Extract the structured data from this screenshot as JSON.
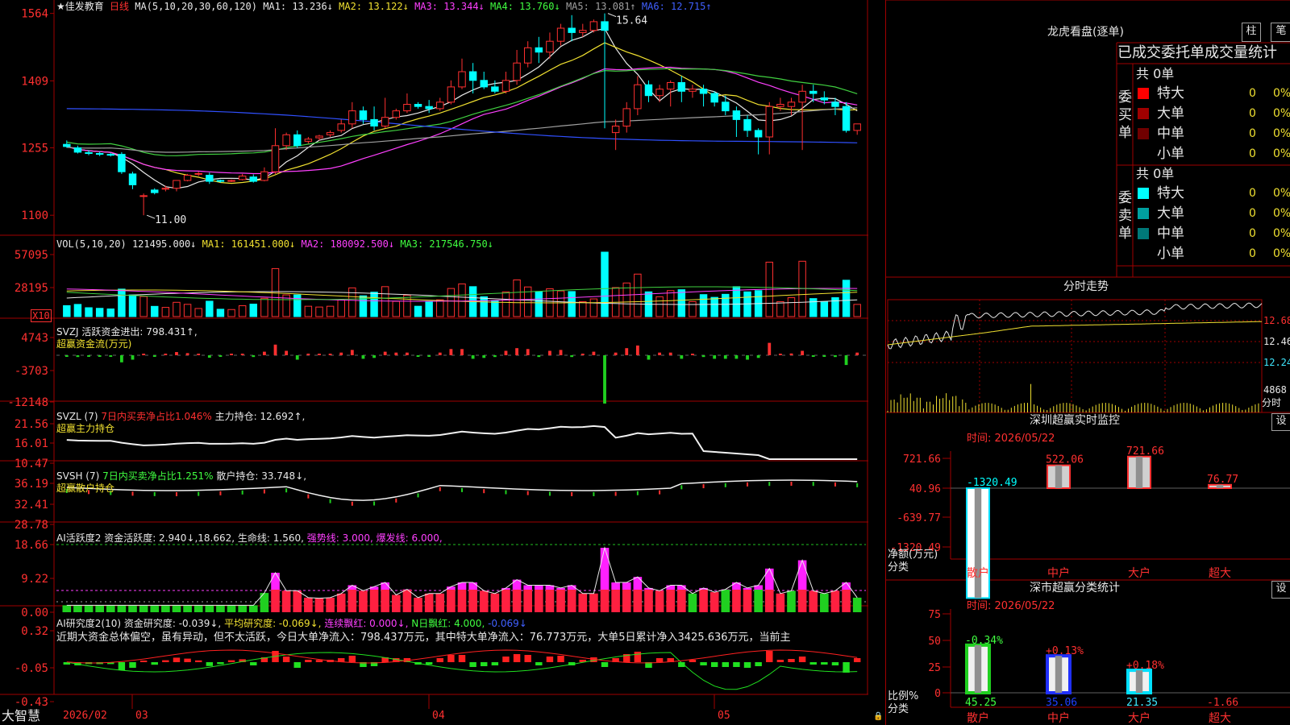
{
  "main": {
    "title": "★佳发教育",
    "period": "日线",
    "ma_header": "MA(5,10,20,30,60,120)",
    "ma1": "MA1: 13.236↓",
    "ma2": "MA2: 13.122↓",
    "ma3": "MA3: 13.344↓",
    "ma4": "MA4: 13.760↓",
    "ma5": "MA5: 13.081↑",
    "ma6": "MA6: 12.715↑",
    "y_ticks": [
      "1564",
      "1409",
      "1255",
      "1100"
    ],
    "high_mark": "15.64",
    "low_mark": "11.00"
  },
  "vol": {
    "header": "VOL(5,10,20)",
    "value": "121495.000↓",
    "ma1": "MA1: 161451.000↓",
    "ma2": "MA2: 180092.500↓",
    "ma3": "MA3: 217546.750↓",
    "y_ticks": [
      "57095",
      "28195"
    ],
    "unit": "X10"
  },
  "svzj": {
    "header": "SVZJ  活跃资金进出: 798.431↑,",
    "sub": "超赢资金流(万元)",
    "y_ticks": [
      "4743",
      "-3703",
      "-12148"
    ]
  },
  "svzl": {
    "header": "SVZL (7)",
    "pct": "7日内买卖净占比1.046%",
    "hold": "主力持仓: 12.692↑,",
    "sub": "超赢主力持仓",
    "y_ticks": [
      "21.56",
      "16.01",
      "10.47"
    ]
  },
  "svsh": {
    "header": "SVSH (7)",
    "pct": "7日内买卖净占比1.251%",
    "hold": "散户持仓: 33.748↓,",
    "sub": "超赢散户持仓",
    "y_ticks": [
      "36.19",
      "32.41",
      "28.78"
    ]
  },
  "ai1": {
    "header": "AI活跃度2 资金活跃度: 2.940↓,18.662,",
    "life": "生命线: 1.560,",
    "strong": "强势线: 3.000,",
    "burst": "爆发线: 6.000,",
    "y_ticks": [
      "18.66",
      "9.22",
      "0.00"
    ]
  },
  "ai2": {
    "header": "AI研究度2(10) 资金研究度: -0.039↓,",
    "avg": "平均研究度: -0.069↓,",
    "lianxu": "连续飘红: 0.000↓,",
    "nri": "N日飘红: 4.000,",
    "last": "-0.069↓",
    "comment": "近期大资金总体偏空，虽有异动，但不太活跃，今日大单净流入：798.437万元，其中特大单净流入：76.773万元，大单5日累计净入3425.636万元，当前主",
    "y_ticks": [
      "0.32",
      "-0.05",
      "-0.43"
    ]
  },
  "bottom": {
    "brand": "大智慧",
    "dates": [
      "2026/02",
      "03",
      "04",
      "05"
    ]
  },
  "right": {
    "dragon_title": "龙虎看盘(逐单)",
    "btn_zhu": "柱",
    "btn_bi": "笔",
    "stat_title": "已成交委托单成交量统计",
    "buy_label": "委买单",
    "sell_label": "委卖单",
    "buy_total": "共 0单",
    "sell_total": "共 0单",
    "buy_rows": [
      {
        "name": "特大",
        "count": "0",
        "pct": "0%",
        "color": "#ff0000"
      },
      {
        "name": "大单",
        "count": "0",
        "pct": "0%",
        "color": "#a00000"
      },
      {
        "name": "中单",
        "count": "0",
        "pct": "0%",
        "color": "#700000"
      },
      {
        "name": "小单",
        "count": "0",
        "pct": "0%",
        "color": ""
      }
    ],
    "sell_rows": [
      {
        "name": "特大",
        "count": "0",
        "pct": "0%",
        "color": "#00ffff"
      },
      {
        "name": "大单",
        "count": "0",
        "pct": "0%",
        "color": "#00a0a0"
      },
      {
        "name": "中单",
        "count": "0",
        "pct": "0%",
        "color": "#007878"
      },
      {
        "name": "小单",
        "count": "0",
        "pct": "0%",
        "color": ""
      }
    ],
    "fenshi_title": "分时走势",
    "fenshi_ticks": [
      "12.68",
      "12.46",
      "12.24"
    ],
    "fenshi_vol": "4868",
    "fenshi_unit": "分时",
    "sz_title": "深圳超赢实时监控",
    "sz_btn": "设",
    "sz_time": "时间: 2026/05/22",
    "sz_ticks": [
      "721.66",
      "40.96",
      "-639.77",
      "-1320.49"
    ],
    "sz_net_label": "净额(万元)",
    "sz_cat_label": "分类",
    "sz_bars": [
      {
        "cat": "散户",
        "value": -1320.49,
        "label": "-1320.49"
      },
      {
        "cat": "中户",
        "value": 522.06,
        "label": "522.06"
      },
      {
        "cat": "大户",
        "value": 721.66,
        "label": "721.66"
      },
      {
        "cat": "超大",
        "value": 76.77,
        "label": "76.77"
      }
    ],
    "ss_title": "深市超赢分类统计",
    "ss_btn": "设",
    "ss_time": "时间: 2026/05/22",
    "ss_ticks": [
      "75",
      "50",
      "25",
      "0"
    ],
    "ss_pct_label": "比例%",
    "ss_cat_label": "分类",
    "ss_bars": [
      {
        "cat": "散户",
        "value": 45.25,
        "label": "45.25",
        "change": "-0.34%"
      },
      {
        "cat": "中户",
        "value": 35.06,
        "label": "35.06",
        "change": "+0.13%"
      },
      {
        "cat": "大户",
        "value": 21.35,
        "label": "21.35",
        "change": "+0.18%"
      },
      {
        "cat": "超大",
        "value": -1.66,
        "label": "-1.66",
        "change": ""
      }
    ]
  },
  "colors": {
    "up": "#ff3030",
    "down": "#00ffff",
    "grid": "#a00000"
  },
  "chart_data": {
    "type": "candlestick",
    "title": "佳发教育 日线",
    "ylim": [
      10.8,
      15.8
    ],
    "candles": [
      [
        12.63,
        12.72,
        12.58,
        12.55
      ],
      [
        12.55,
        12.6,
        12.45,
        12.42
      ],
      [
        12.44,
        12.5,
        12.42,
        12.38
      ],
      [
        12.42,
        12.46,
        12.4,
        12.36
      ],
      [
        12.4,
        12.43,
        12.38,
        12.35
      ],
      [
        12.4,
        12.45,
        12.0,
        11.95
      ],
      [
        11.95,
        12.0,
        11.7,
        11.6
      ],
      [
        11.45,
        11.5,
        11.45,
        11.0
      ],
      [
        11.58,
        11.62,
        11.52,
        11.48
      ],
      [
        11.6,
        11.68,
        11.62,
        11.55
      ],
      [
        11.62,
        11.75,
        11.8,
        11.55
      ],
      [
        11.8,
        11.95,
        11.92,
        11.78
      ],
      [
        11.95,
        12.0,
        11.96,
        11.9
      ],
      [
        11.92,
        11.98,
        11.78,
        11.72
      ],
      [
        11.8,
        11.82,
        11.78,
        11.75
      ],
      [
        11.78,
        11.82,
        11.8,
        11.76
      ],
      [
        11.82,
        11.95,
        11.9,
        11.8
      ],
      [
        11.88,
        11.94,
        11.78,
        11.75
      ],
      [
        11.8,
        12.1,
        12.0,
        11.78
      ],
      [
        12.0,
        13.0,
        12.6,
        11.95
      ],
      [
        12.6,
        12.9,
        12.85,
        12.5
      ],
      [
        12.85,
        12.95,
        12.6,
        12.55
      ],
      [
        12.7,
        12.8,
        12.75,
        12.65
      ],
      [
        12.78,
        12.85,
        12.82,
        12.72
      ],
      [
        12.85,
        12.95,
        12.9,
        12.8
      ],
      [
        12.95,
        13.2,
        13.1,
        12.9
      ],
      [
        13.1,
        13.6,
        13.4,
        13.0
      ],
      [
        13.4,
        13.5,
        13.2,
        13.1
      ],
      [
        13.2,
        13.5,
        13.05,
        12.95
      ],
      [
        13.05,
        13.7,
        13.25,
        13.0
      ],
      [
        13.25,
        13.45,
        13.4,
        13.2
      ],
      [
        13.4,
        13.8,
        13.55,
        13.35
      ],
      [
        13.55,
        13.6,
        13.5,
        13.45
      ],
      [
        13.5,
        13.65,
        13.45,
        13.35
      ],
      [
        13.45,
        13.7,
        13.6,
        13.4
      ],
      [
        13.6,
        14.1,
        13.95,
        13.55
      ],
      [
        13.95,
        14.6,
        14.3,
        13.9
      ],
      [
        14.3,
        14.5,
        14.1,
        13.8
      ],
      [
        14.1,
        14.3,
        13.95,
        13.9
      ],
      [
        13.95,
        14.1,
        13.85,
        13.8
      ],
      [
        13.85,
        14.3,
        14.1,
        13.8
      ],
      [
        14.1,
        14.8,
        14.5,
        14.0
      ],
      [
        14.5,
        15.0,
        14.85,
        14.4
      ],
      [
        14.85,
        15.1,
        14.75,
        14.5
      ],
      [
        14.75,
        15.2,
        15.0,
        14.6
      ],
      [
        15.0,
        15.4,
        15.3,
        14.9
      ],
      [
        15.3,
        15.6,
        15.2,
        15.0
      ],
      [
        15.2,
        15.4,
        15.25,
        15.1
      ],
      [
        15.25,
        15.5,
        15.45,
        15.2
      ],
      [
        15.45,
        15.64,
        15.25,
        13.0
      ],
      [
        12.9,
        13.2,
        13.05,
        12.5
      ],
      [
        13.05,
        13.6,
        13.45,
        12.9
      ],
      [
        13.45,
        14.2,
        14.0,
        13.3
      ],
      [
        14.0,
        14.1,
        13.75,
        13.6
      ],
      [
        13.75,
        14.0,
        13.9,
        13.6
      ],
      [
        13.9,
        14.1,
        14.05,
        13.5
      ],
      [
        14.05,
        14.2,
        13.85,
        13.6
      ],
      [
        13.85,
        14.0,
        13.9,
        13.7
      ],
      [
        13.9,
        14.0,
        13.8,
        13.5
      ],
      [
        13.8,
        13.85,
        13.6,
        13.5
      ],
      [
        13.6,
        13.75,
        13.4,
        13.3
      ],
      [
        13.4,
        13.5,
        13.2,
        12.8
      ],
      [
        13.2,
        13.3,
        12.95,
        12.8
      ],
      [
        12.95,
        13.0,
        12.8,
        12.4
      ],
      [
        12.8,
        13.6,
        13.5,
        12.4
      ],
      [
        13.5,
        13.7,
        13.55,
        13.4
      ],
      [
        13.5,
        13.7,
        13.6,
        13.3
      ],
      [
        13.6,
        14.0,
        13.85,
        12.5
      ],
      [
        13.85,
        14.0,
        13.8,
        13.6
      ],
      [
        13.7,
        13.85,
        13.65,
        13.55
      ],
      [
        13.6,
        13.7,
        13.5,
        13.3
      ],
      [
        13.5,
        13.6,
        12.95,
        12.9
      ],
      [
        12.95,
        13.0,
        13.1,
        12.85
      ]
    ]
  }
}
